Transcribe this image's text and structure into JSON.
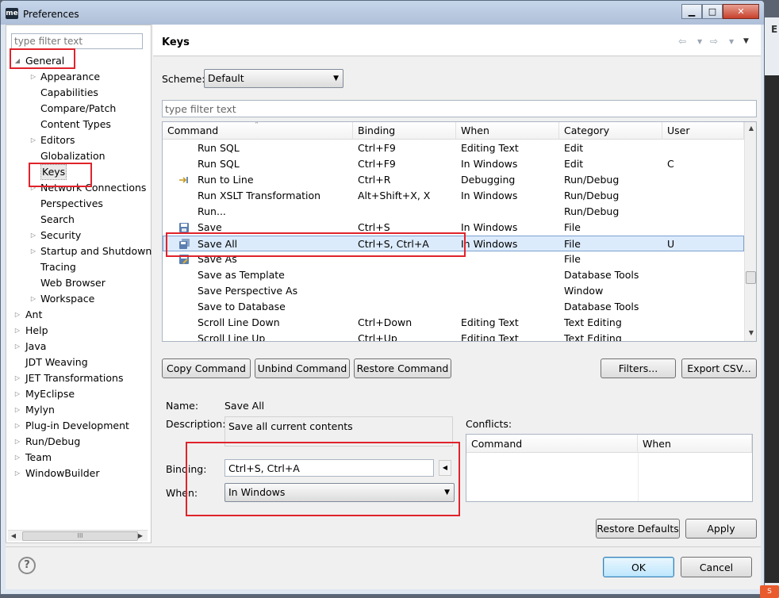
{
  "window": {
    "title": "Preferences",
    "app_icon": "me",
    "minimize": "▁",
    "maximize": "□",
    "close": "✕"
  },
  "background": {
    "label": "E",
    "badge": "S"
  },
  "tree": {
    "filter_placeholder": "type filter text",
    "items": [
      {
        "label": "General",
        "state": "expanded"
      },
      {
        "label": "Appearance",
        "state": "collapsed"
      },
      {
        "label": "Capabilities",
        "state": "leaf"
      },
      {
        "label": "Compare/Patch",
        "state": "leaf"
      },
      {
        "label": "Content Types",
        "state": "leaf"
      },
      {
        "label": "Editors",
        "state": "collapsed"
      },
      {
        "label": "Globalization",
        "state": "leaf"
      },
      {
        "label": "Keys",
        "state": "leaf"
      },
      {
        "label": "Network Connections",
        "state": "collapsed"
      },
      {
        "label": "Perspectives",
        "state": "leaf"
      },
      {
        "label": "Search",
        "state": "leaf"
      },
      {
        "label": "Security",
        "state": "collapsed"
      },
      {
        "label": "Startup and Shutdown",
        "state": "collapsed"
      },
      {
        "label": "Tracing",
        "state": "leaf"
      },
      {
        "label": "Web Browser",
        "state": "leaf"
      },
      {
        "label": "Workspace",
        "state": "collapsed"
      },
      {
        "label": "Ant",
        "state": "collapsed"
      },
      {
        "label": "Help",
        "state": "collapsed"
      },
      {
        "label": "Java",
        "state": "collapsed"
      },
      {
        "label": "JDT Weaving",
        "state": "leaf"
      },
      {
        "label": "JET Transformations",
        "state": "collapsed"
      },
      {
        "label": "MyEclipse",
        "state": "collapsed"
      },
      {
        "label": "Mylyn",
        "state": "collapsed"
      },
      {
        "label": "Plug-in Development",
        "state": "collapsed"
      },
      {
        "label": "Run/Debug",
        "state": "collapsed"
      },
      {
        "label": "Team",
        "state": "collapsed"
      },
      {
        "label": "WindowBuilder",
        "state": "collapsed"
      }
    ],
    "hscroll_left": "◀",
    "hscroll_right": "▶",
    "hscroll_grip": "III"
  },
  "page": {
    "title": "Keys",
    "nav": {
      "back": "⇦",
      "back_menu": "▼",
      "forward": "⇨",
      "forward_menu": "▼",
      "view_menu": "▼"
    },
    "scheme": {
      "label": "Scheme:",
      "value": "Default",
      "arrow": "▼"
    },
    "filter_placeholder": "type filter text",
    "table": {
      "headers": [
        "Command",
        "Binding",
        "When",
        "Category",
        "User"
      ],
      "sort_indicator": "˄",
      "rows": [
        {
          "command": "Run SQL",
          "binding": "Ctrl+F9",
          "when": "Editing Text",
          "category": "Edit",
          "user": "",
          "icon": ""
        },
        {
          "command": "Run SQL",
          "binding": "Ctrl+F9",
          "when": "In Windows",
          "category": "Edit",
          "user": "C",
          "icon": ""
        },
        {
          "command": "Run to Line",
          "binding": "Ctrl+R",
          "when": "Debugging",
          "category": "Run/Debug",
          "user": "",
          "icon": "run-to-line"
        },
        {
          "command": "Run XSLT Transformation",
          "binding": "Alt+Shift+X, X",
          "when": "In Windows",
          "category": "Run/Debug",
          "user": "",
          "icon": ""
        },
        {
          "command": "Run...",
          "binding": "",
          "when": "",
          "category": "Run/Debug",
          "user": "",
          "icon": ""
        },
        {
          "command": "Save",
          "binding": "Ctrl+S",
          "when": "In Windows",
          "category": "File",
          "user": "",
          "icon": "save"
        },
        {
          "command": "Save All",
          "binding": "Ctrl+S, Ctrl+A",
          "when": "In Windows",
          "category": "File",
          "user": "U",
          "icon": "save-all",
          "selected": true
        },
        {
          "command": "Save As",
          "binding": "",
          "when": "",
          "category": "File",
          "user": "",
          "icon": "save-as"
        },
        {
          "command": "Save as Template",
          "binding": "",
          "when": "",
          "category": "Database Tools",
          "user": "",
          "icon": ""
        },
        {
          "command": "Save Perspective As",
          "binding": "",
          "when": "",
          "category": "Window",
          "user": "",
          "icon": ""
        },
        {
          "command": "Save to Database",
          "binding": "",
          "when": "",
          "category": "Database Tools",
          "user": "",
          "icon": ""
        },
        {
          "command": "Scroll Line Down",
          "binding": "Ctrl+Down",
          "when": "Editing Text",
          "category": "Text Editing",
          "user": "",
          "icon": ""
        },
        {
          "command": "Scroll Line Up",
          "binding": "Ctrl+Up",
          "when": "Editing Text",
          "category": "Text Editing",
          "user": "",
          "icon": ""
        }
      ],
      "scroll_up": "▲",
      "scroll_down": "▼"
    },
    "buttons": {
      "copy": "Copy Command",
      "unbind": "Unbind Command",
      "restore": "Restore Command",
      "filters": "Filters...",
      "export": "Export CSV..."
    },
    "details": {
      "name_label": "Name:",
      "name_value": "Save All",
      "description_label": "Description:",
      "description_value": "Save all current contents",
      "binding_label": "Binding:",
      "binding_value": "Ctrl+S, Ctrl+A",
      "binding_arrow": "◀",
      "when_label": "When:",
      "when_value": "In Windows",
      "when_arrow": "▼"
    },
    "conflicts": {
      "label": "Conflicts:",
      "headers": [
        "Command",
        "When"
      ]
    },
    "restore_defaults": "Restore Defaults",
    "apply": "Apply"
  },
  "footer": {
    "help": "?",
    "ok": "OK",
    "cancel": "Cancel"
  },
  "colors": {
    "selection": "#dcebfc",
    "annotation": "#e0232b",
    "title_bar": "#b8c9e1"
  }
}
